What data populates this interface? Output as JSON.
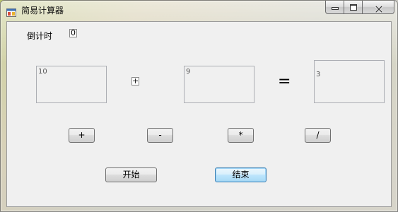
{
  "window": {
    "title": "简易计算器"
  },
  "form": {
    "countdown_label": "倒计时",
    "countdown_value": "0",
    "operand1": "10",
    "operator": "+",
    "operand2": "9",
    "equals": "=",
    "result": "3"
  },
  "buttons": {
    "plus": "+",
    "minus": "-",
    "multiply": "*",
    "divide": "/",
    "start": "开始",
    "stop": "结束"
  },
  "icons": {
    "app": "app-icon",
    "minimize": "minimize-icon",
    "maximize": "maximize-icon",
    "close": "close-icon"
  },
  "colors": {
    "client_background": "#f0f0f0",
    "focused_button_border": "#3c7fb1",
    "textbox_border": "#abadb3"
  }
}
